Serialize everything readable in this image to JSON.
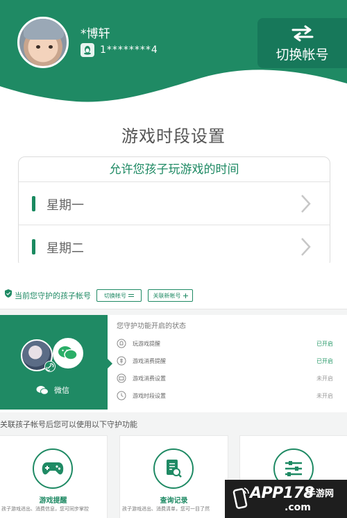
{
  "top": {
    "username": "*博轩",
    "qq_number": "1********4",
    "switch_label": "切换帐号",
    "settings_title": "游戏时段设置",
    "allow_heading": "允许您孩子玩游戏的时间",
    "days": [
      "星期一",
      "星期二"
    ]
  },
  "bottom": {
    "guard_title": "当前您守护的孩子帐号",
    "switch_btn": "切换帐号",
    "link_btn": "关联新帐号",
    "channel": "微信",
    "status_title": "您守护功能开启的状态",
    "status_items": [
      {
        "name": "玩游戏提醒",
        "state": "已开启"
      },
      {
        "name": "游戏消费提醒",
        "state": "已开启"
      },
      {
        "name": "游戏消费设置",
        "state": "未开启"
      },
      {
        "name": "游戏时段设置",
        "state": "未开启"
      }
    ],
    "features_title": "关联孩子帐号后您可以使用以下守护功能",
    "features": [
      {
        "name": "游戏提醒",
        "desc": "孩子游戏进出、消费信息，您可同步掌控"
      },
      {
        "name": "查询记录",
        "desc": "孩子游戏进出、消费清单，您可一目了然"
      },
      {
        "name": "",
        "desc": ""
      }
    ]
  },
  "watermark": {
    "brand": "APP178",
    "site_name": "手游网",
    "domain": ".com"
  },
  "colors": {
    "brand_green": "#1f8a64",
    "dark_green": "#17785a"
  },
  "icons": {
    "switch": "swap-arrows-icon",
    "qq": "qq-penguin-icon",
    "wechat": "wechat-icon",
    "gamepad": "gamepad-icon",
    "records": "document-search-icon",
    "settings": "sliders-icon"
  }
}
